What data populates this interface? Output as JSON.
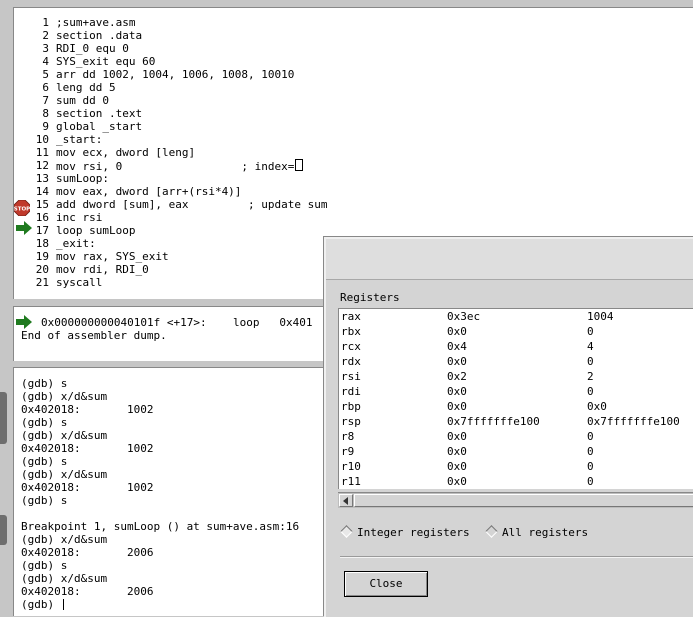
{
  "source": {
    "lines": [
      {
        "num": "1",
        "text": ";sum+ave.asm"
      },
      {
        "num": "2",
        "text": "section .data"
      },
      {
        "num": "3",
        "text": "RDI_0 equ 0"
      },
      {
        "num": "4",
        "text": "SYS_exit equ 60"
      },
      {
        "num": "5",
        "text": "arr dd 1002, 1004, 1006, 1008, 10010"
      },
      {
        "num": "6",
        "text": "leng dd 5"
      },
      {
        "num": "7",
        "text": "sum dd 0"
      },
      {
        "num": "8",
        "text": "section .text"
      },
      {
        "num": "9",
        "text": "global _start"
      },
      {
        "num": "10",
        "text": "_start:"
      },
      {
        "num": "11",
        "text": "mov ecx, dword [leng]"
      },
      {
        "num": "12",
        "text": "mov rsi, 0                  ; index="
      },
      {
        "num": "13",
        "text": "sumLoop:"
      },
      {
        "num": "14",
        "text": "mov eax, dword [arr+(rsi*4)]"
      },
      {
        "num": "15",
        "text": "add dword [sum], eax         ; update sum"
      },
      {
        "num": "16",
        "text": "inc rsi"
      },
      {
        "num": "17",
        "text": "loop sumLoop"
      },
      {
        "num": "18",
        "text": "_exit:"
      },
      {
        "num": "19",
        "text": "mov rax, SYS_exit"
      },
      {
        "num": "20",
        "text": "mov rdi, RDI_0"
      },
      {
        "num": "21",
        "text": "syscall"
      }
    ],
    "breakpoint_icon": "stop-sign-icon",
    "current_line_icon": "green-arrow-icon"
  },
  "assembler": {
    "line1": "0x000000000040101f <+17>:    loop   0x401",
    "line2": "End of assembler dump."
  },
  "console": {
    "lines": [
      "(gdb) s",
      "(gdb) x/d&sum",
      "0x402018:       1002",
      "(gdb) s",
      "(gdb) x/d&sum",
      "0x402018:       1002",
      "(gdb) s",
      "(gdb) x/d&sum",
      "0x402018:       1002",
      "(gdb) s",
      "",
      "Breakpoint 1, sumLoop () at sum+ave.asm:16",
      "(gdb) x/d&sum",
      "0x402018:       2006",
      "(gdb) s",
      "(gdb) x/d&sum",
      "0x402018:       2006",
      "(gdb) "
    ]
  },
  "registers_dialog": {
    "heading": "Registers",
    "rows": [
      {
        "name": "rax",
        "hex": "0x3ec",
        "value": "1004"
      },
      {
        "name": "rbx",
        "hex": "0x0",
        "value": "0"
      },
      {
        "name": "rcx",
        "hex": "0x4",
        "value": "4"
      },
      {
        "name": "rdx",
        "hex": "0x0",
        "value": "0"
      },
      {
        "name": "rsi",
        "hex": "0x2",
        "value": "2"
      },
      {
        "name": "rdi",
        "hex": "0x0",
        "value": "0"
      },
      {
        "name": "rbp",
        "hex": "0x0",
        "value": "0x0"
      },
      {
        "name": "rsp",
        "hex": "0x7fffffffe100",
        "value": "0x7fffffffe100"
      },
      {
        "name": "r8",
        "hex": "0x0",
        "value": "0"
      },
      {
        "name": "r9",
        "hex": "0x0",
        "value": "0"
      },
      {
        "name": "r10",
        "hex": "0x0",
        "value": "0"
      },
      {
        "name": "r11",
        "hex": "0x0",
        "value": "0"
      }
    ],
    "radio_integer": "Integer registers",
    "radio_all": "All registers",
    "close_label": "Close"
  },
  "colors": {
    "stop": "#c0392b",
    "arrow": "#1f7a1f"
  }
}
